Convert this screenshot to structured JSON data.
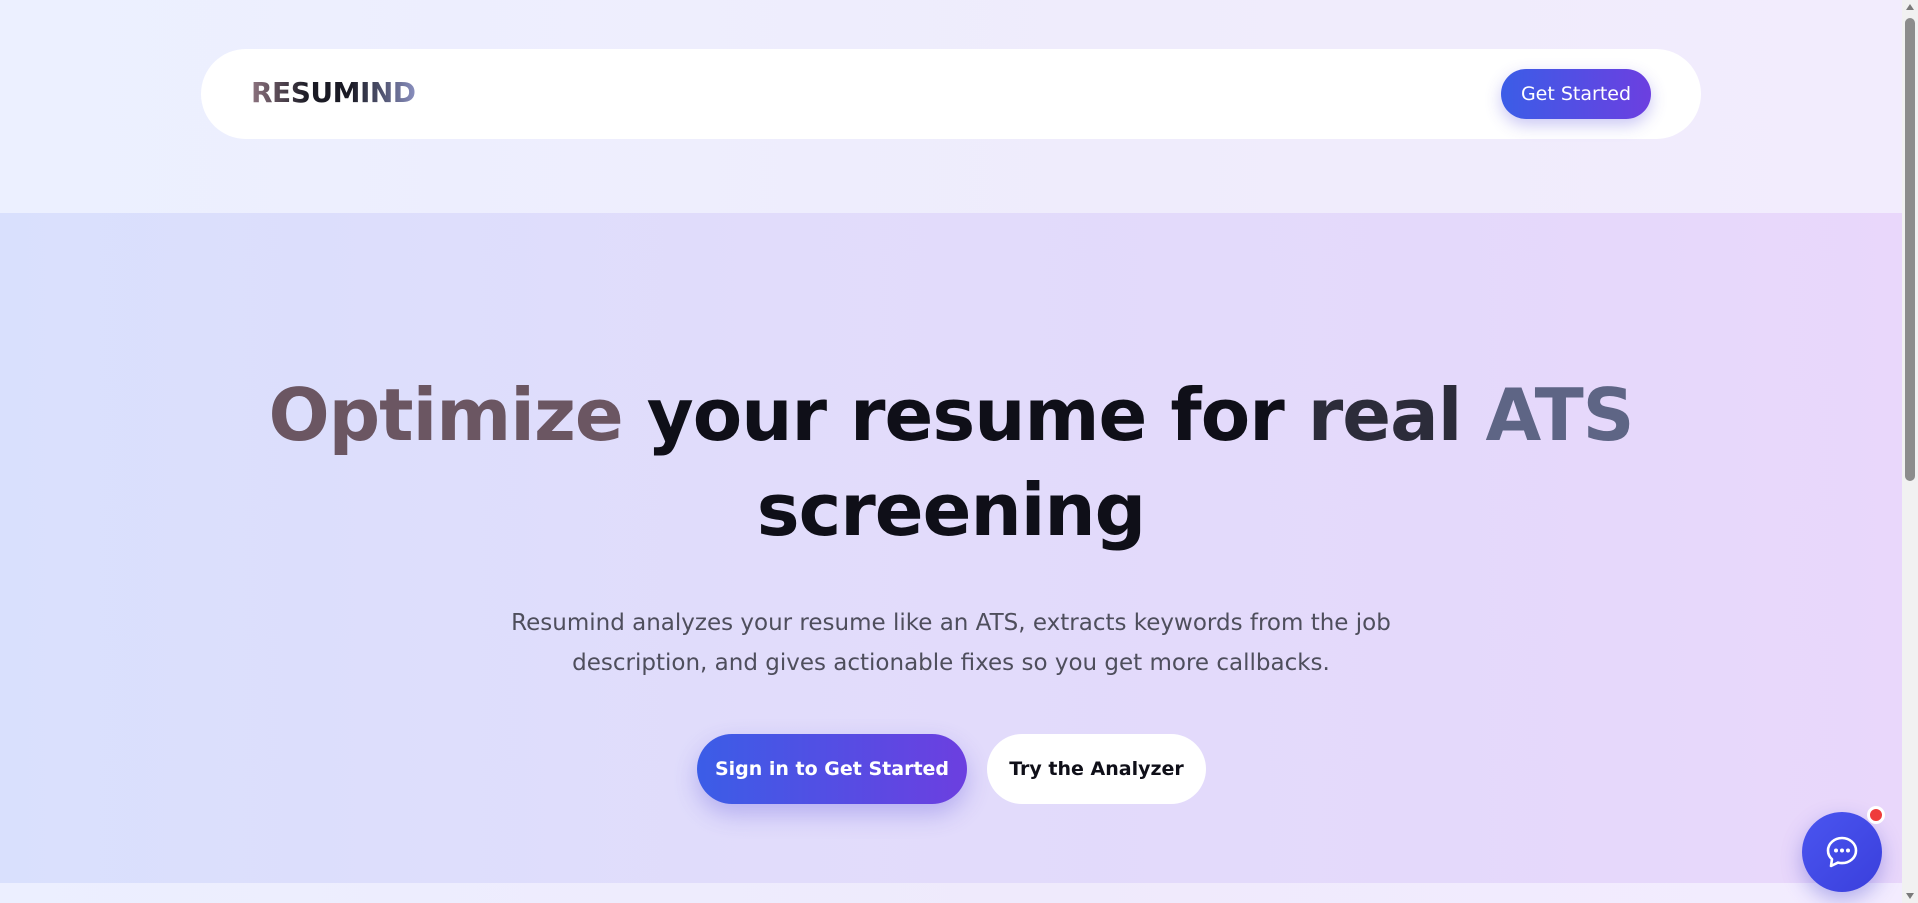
{
  "navbar": {
    "logo_text": "RESUMIND",
    "cta_label": "Get Started"
  },
  "hero": {
    "headline_part1": "Optimize ",
    "headline_part2": "your resume for ",
    "headline_part3": "real ",
    "headline_part4": "ATS",
    "headline_part5": "screening",
    "subtext": "Resumind analyzes your resume like an ATS, extracts keywords from the job description, and gives actionable fixes so you get more callbacks.",
    "primary_button_label": "Sign in to Get Started",
    "secondary_button_label": "Try the Analyzer"
  },
  "chat_widget": {
    "icon": "chat-bubble-icon",
    "has_notification": true
  },
  "colors": {
    "accent_start": "#3b5de7",
    "accent_end": "#6c3fe0",
    "notification": "#ef3b3b"
  }
}
